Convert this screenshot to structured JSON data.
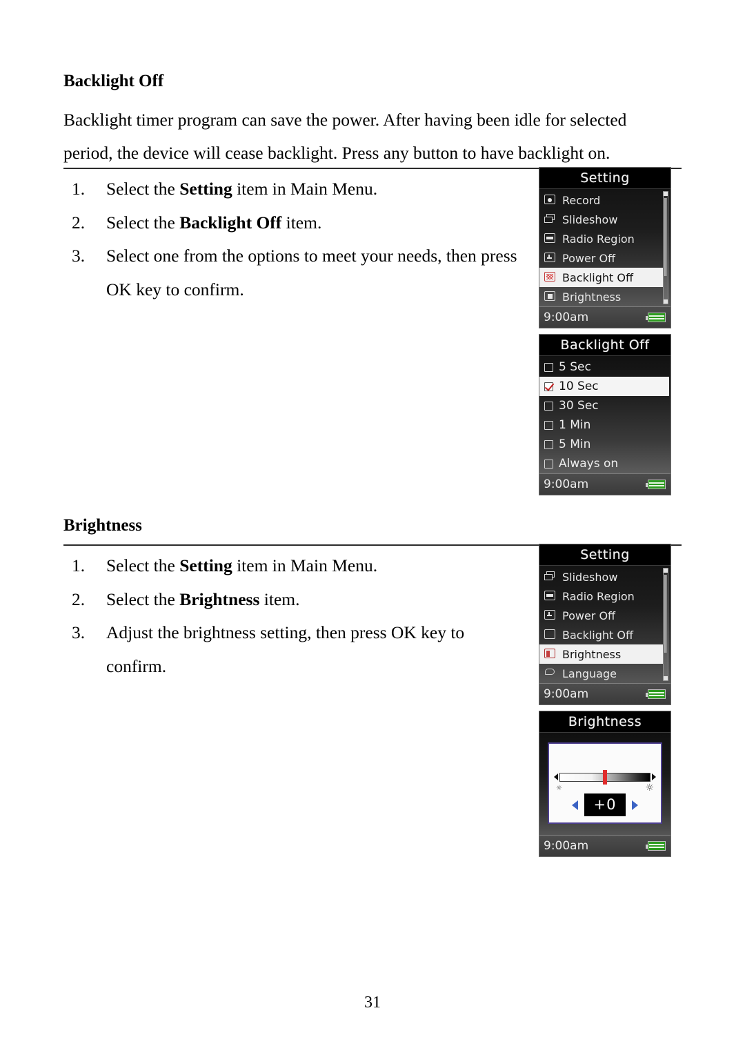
{
  "document": {
    "page_number": "31"
  },
  "sections": [
    {
      "heading": "Backlight Off",
      "paragraph": "Backlight timer program can save the power. After having been idle for selected period, the device will cease backlight. Press any button to have backlight on.",
      "steps": [
        {
          "num": "1.",
          "prefix": "Select the ",
          "bold": "Setting",
          "suffix": " item in Main Menu."
        },
        {
          "num": "2.",
          "prefix": "Select the ",
          "bold": "Backlight Off",
          "suffix": " item."
        },
        {
          "num": "3.",
          "prefix": "Select one from the options to meet your needs, then press OK key to confirm.",
          "bold": "",
          "suffix": ""
        }
      ]
    },
    {
      "heading": "Brightness",
      "steps": [
        {
          "num": "1.",
          "prefix": "Select the ",
          "bold": "Setting",
          "suffix": " item in Main Menu."
        },
        {
          "num": "2.",
          "prefix": "Select the ",
          "bold": "Brightness",
          "suffix": " item."
        },
        {
          "num": "3.",
          "prefix": "Adjust the brightness setting, then press OK key to confirm.",
          "bold": "",
          "suffix": ""
        }
      ]
    }
  ],
  "devices": {
    "setting_menu_1": {
      "title": "Setting",
      "items": [
        {
          "icon": "record-icon",
          "label": "Record",
          "selected": false
        },
        {
          "icon": "slideshow-icon",
          "label": "Slideshow",
          "selected": false
        },
        {
          "icon": "radio-region-icon",
          "label": "Radio Region",
          "selected": false
        },
        {
          "icon": "power-off-icon",
          "label": "Power Off",
          "selected": false
        },
        {
          "icon": "backlight-off-icon",
          "label": "Backlight Off",
          "selected": true
        },
        {
          "icon": "brightness-icon",
          "label": "Brightness",
          "selected": false
        }
      ],
      "status": {
        "time": "9:00am",
        "battery": "battery-full-icon"
      }
    },
    "backlight_off_menu": {
      "title": "Backlight Off",
      "options": [
        {
          "label": "5 Sec",
          "checked": false
        },
        {
          "label": "10 Sec",
          "checked": true
        },
        {
          "label": "30 Sec",
          "checked": false
        },
        {
          "label": "1 Min",
          "checked": false
        },
        {
          "label": "5 Min",
          "checked": false
        },
        {
          "label": "Always on",
          "checked": false
        }
      ],
      "status": {
        "time": "9:00am",
        "battery": "battery-full-icon"
      }
    },
    "setting_menu_2": {
      "title": "Setting",
      "items": [
        {
          "icon": "slideshow-icon",
          "label": "Slideshow",
          "selected": false
        },
        {
          "icon": "radio-region-icon",
          "label": "Radio Region",
          "selected": false
        },
        {
          "icon": "power-off-icon",
          "label": "Power Off",
          "selected": false
        },
        {
          "icon": "backlight-off-icon",
          "label": "Backlight Off",
          "selected": false
        },
        {
          "icon": "brightness-icon",
          "label": "Brightness",
          "selected": true
        },
        {
          "icon": "language-icon",
          "label": "Language",
          "selected": false
        }
      ],
      "status": {
        "time": "9:00am",
        "battery": "battery-full-icon"
      }
    },
    "brightness_adjust": {
      "title": "Brightness",
      "value": "+0",
      "slider_position_percent": 50,
      "left_icon": "dim-sun-icon",
      "right_icon": "bright-sun-icon",
      "decrease_icon": "left-triangle-icon",
      "increase_icon": "right-triangle-icon",
      "status": {
        "time": "9:00am",
        "battery": "battery-full-icon"
      }
    }
  },
  "colors": {
    "accent_red": "#c12020",
    "battery_green": "#2d9b1f",
    "panel_border": "#4c3e8e",
    "arrow_blue": "#3b63c4"
  }
}
